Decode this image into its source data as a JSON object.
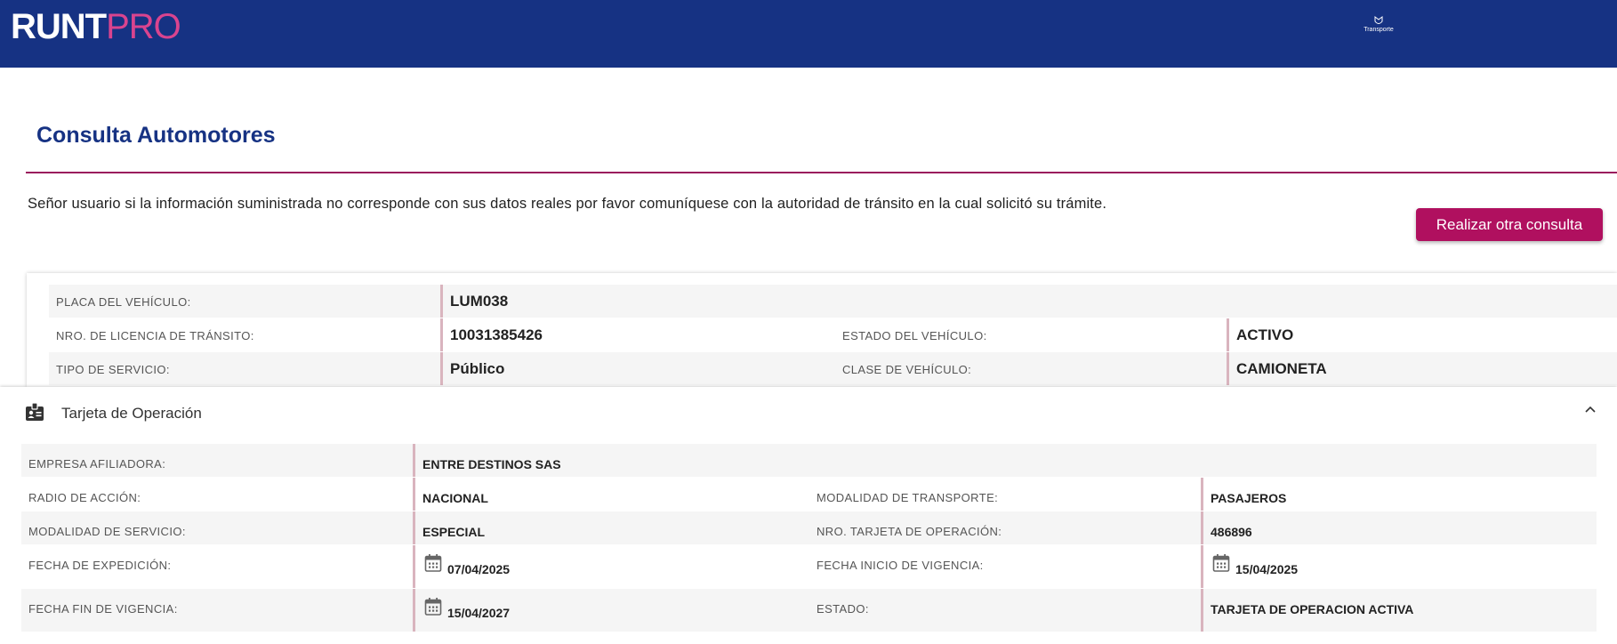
{
  "header": {
    "logo_primary": "RUNT",
    "logo_secondary": "PRO",
    "ministry_label": "Transporte",
    "colors": {
      "bar": "#163283",
      "logo_accent": "#d9448f"
    }
  },
  "page": {
    "title": "Consulta Automotores",
    "notice": "Señor usuario si la información suministrada no corresponde con sus datos reales por favor comuníquese con la autoridad de tránsito en la cual solicitó su trámite.",
    "new_query_button": "Realizar otra consulta",
    "colors": {
      "title": "#163283",
      "rule": "#9a1c5d",
      "button": "#b0105f"
    }
  },
  "vehicle": {
    "placa_label": "PLACA DEL VEHÍCULO:",
    "placa_value": "LUM038",
    "licencia_label": "NRO. DE LICENCIA DE TRÁNSITO:",
    "licencia_value": "10031385426",
    "estado_label": "ESTADO DEL VEHÍCULO:",
    "estado_value": "ACTIVO",
    "servicio_label": "TIPO DE SERVICIO:",
    "servicio_value": "Público",
    "clase_label": "CLASE DE VEHÍCULO:",
    "clase_value": "CAMIONETA"
  },
  "tarjeta": {
    "section_title": "Tarjeta de Operación",
    "section_icon": "id-badge-icon",
    "collapse_icon": "chevron-up-icon",
    "empresa_label": "EMPRESA AFILIADORA:",
    "empresa_value": "ENTRE DESTINOS SAS",
    "radio_label": "RADIO DE ACCIÓN:",
    "radio_value": "NACIONAL",
    "modalidad_transporte_label": "MODALIDAD DE TRANSPORTE:",
    "modalidad_transporte_value": "PASAJEROS",
    "modalidad_servicio_label": "MODALIDAD DE SERVICIO:",
    "modalidad_servicio_value": "ESPECIAL",
    "nro_tarjeta_label": "NRO. TARJETA DE OPERACIÓN:",
    "nro_tarjeta_value": "486896",
    "expedicion_label": "FECHA DE EXPEDICIÓN:",
    "expedicion_value": "07/04/2025",
    "inicio_label": "FECHA INICIO DE VIGENCIA:",
    "inicio_value": "15/04/2025",
    "fin_label": "FECHA FIN DE VIGENCIA:",
    "fin_value": "15/04/2027",
    "estado_label": "ESTADO:",
    "estado_value": "TARJETA DE OPERACION ACTIVA",
    "date_icon": "calendar-icon"
  }
}
